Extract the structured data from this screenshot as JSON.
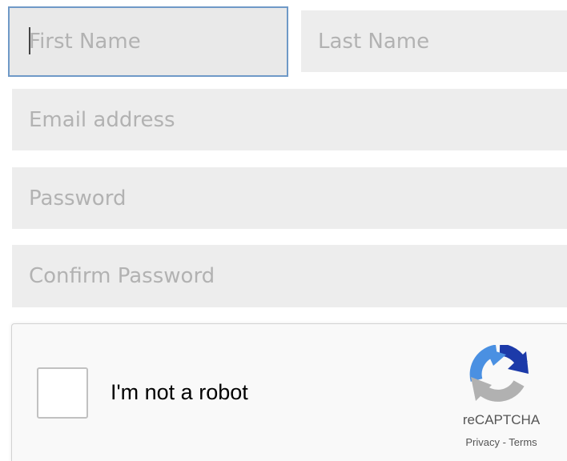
{
  "form": {
    "first_name": {
      "value": "",
      "placeholder": "First Name"
    },
    "last_name": {
      "value": "",
      "placeholder": "Last Name"
    },
    "email": {
      "value": "",
      "placeholder": "Email address"
    },
    "password": {
      "value": "",
      "placeholder": "Password"
    },
    "confirm_password": {
      "value": "",
      "placeholder": "Confirm Password"
    }
  },
  "captcha": {
    "label": "I'm not a robot",
    "brand": "reCAPTCHA",
    "privacy_link": "Privacy",
    "separator": " - ",
    "terms_link": "Terms",
    "checked": false,
    "logo_icon": "recaptcha-logo-icon",
    "colors": {
      "logo_dark_blue": "#1c3aa9",
      "logo_light_blue": "#4a90e2",
      "logo_gray": "#b1b1b1",
      "focus_border": "#6f99c7"
    }
  }
}
